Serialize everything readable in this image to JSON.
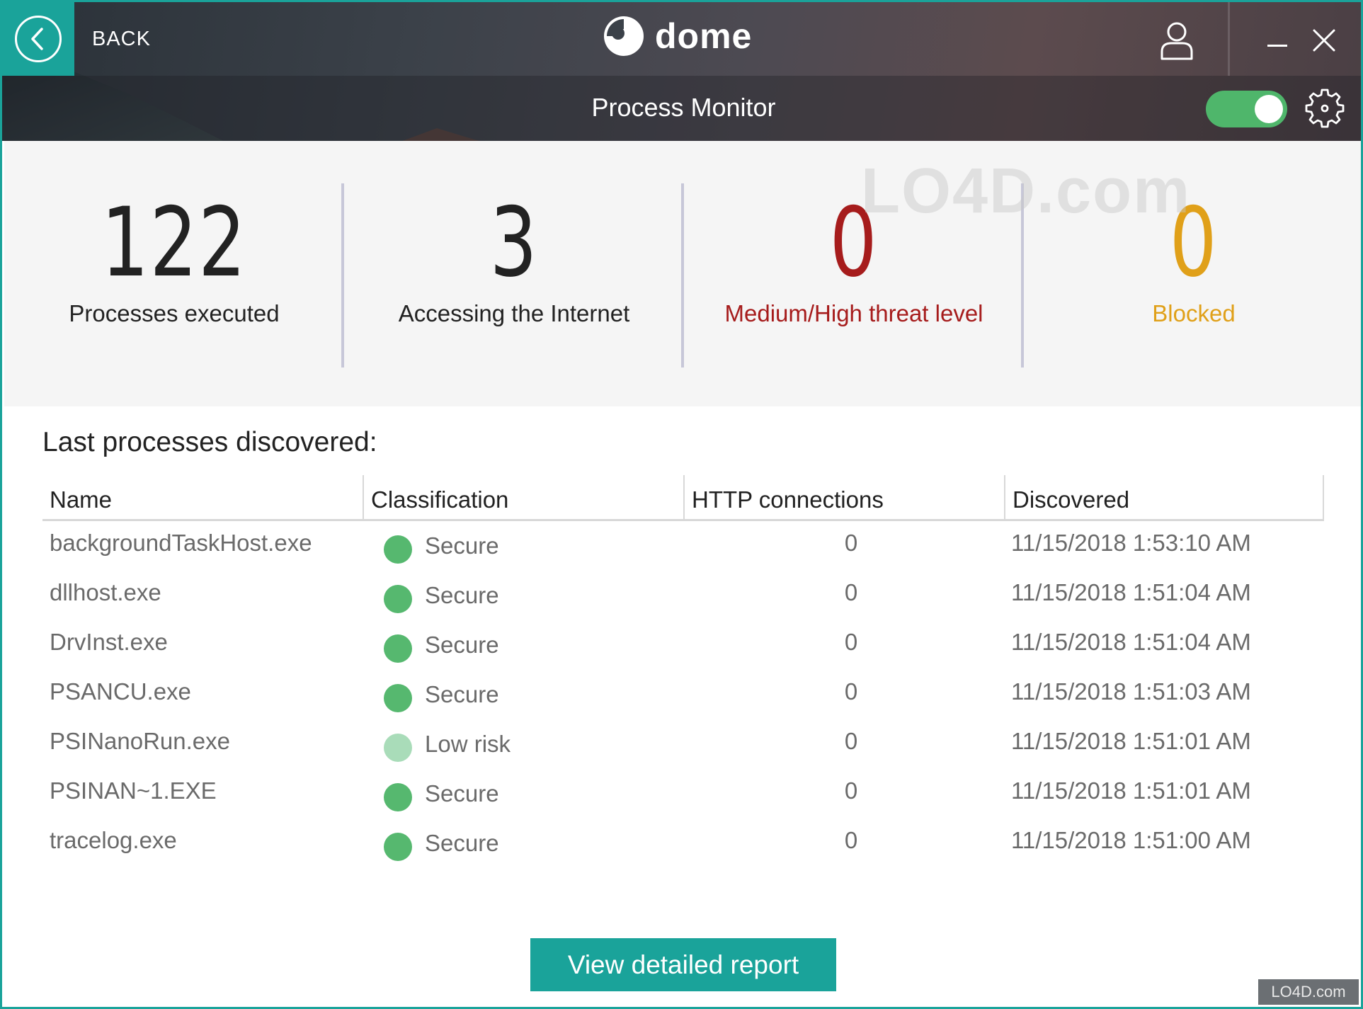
{
  "header": {
    "back_label": "BACK",
    "logo_text": "dome",
    "page_title": "Process Monitor",
    "toggle_on": true,
    "accent_color": "#1aa39a",
    "toggle_color": "#4fb66b"
  },
  "stats": [
    {
      "value": "122",
      "label": "Processes executed",
      "color": "#222222"
    },
    {
      "value": "3",
      "label": "Accessing the Internet",
      "color": "#222222"
    },
    {
      "value": "0",
      "label": "Medium/High threat level",
      "color": "#a61c1c"
    },
    {
      "value": "0",
      "label": "Blocked",
      "color": "#e0a019"
    }
  ],
  "table": {
    "title": "Last processes discovered:",
    "columns": [
      "Name",
      "Classification",
      "HTTP connections",
      "Discovered"
    ],
    "rows": [
      {
        "name": "backgroundTaskHost.exe",
        "classification": "Secure",
        "http": "0",
        "discovered": "11/15/2018 1:53:10 AM",
        "status_color": "#56b86f"
      },
      {
        "name": "dllhost.exe",
        "classification": "Secure",
        "http": "0",
        "discovered": "11/15/2018 1:51:04 AM",
        "status_color": "#56b86f"
      },
      {
        "name": "DrvInst.exe",
        "classification": "Secure",
        "http": "0",
        "discovered": "11/15/2018 1:51:04 AM",
        "status_color": "#56b86f"
      },
      {
        "name": "PSANCU.exe",
        "classification": "Secure",
        "http": "0",
        "discovered": "11/15/2018 1:51:03 AM",
        "status_color": "#56b86f"
      },
      {
        "name": "PSINanoRun.exe",
        "classification": "Low risk",
        "http": "0",
        "discovered": "11/15/2018 1:51:01 AM",
        "status_color": "#a9dcb9"
      },
      {
        "name": "PSINAN~1.EXE",
        "classification": "Secure",
        "http": "0",
        "discovered": "11/15/2018 1:51:01 AM",
        "status_color": "#56b86f"
      },
      {
        "name": "tracelog.exe",
        "classification": "Secure",
        "http": "0",
        "discovered": "11/15/2018 1:51:00 AM",
        "status_color": "#56b86f"
      }
    ]
  },
  "report_button": "View detailed report",
  "watermark": "LO4D.com"
}
